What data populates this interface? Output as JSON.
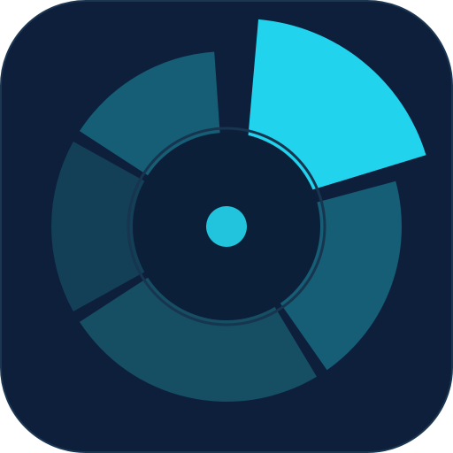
{
  "icon": {
    "semantic": "radial-segment-chart-app-icon",
    "colors": {
      "background": "#0d1f3b",
      "border": "#1c3550",
      "inner_disc": "#0c1f39",
      "inner_ring": "#17354f",
      "center_dot": "#22c4dd",
      "gap": "#0d1f3b"
    },
    "segments": [
      {
        "id": "highlight",
        "color": "#22d3ee",
        "detached": true
      },
      {
        "id": "right",
        "color": "#155e75"
      },
      {
        "id": "bottom",
        "color": "#164e63"
      },
      {
        "id": "left",
        "color": "#133f57"
      },
      {
        "id": "upper-left",
        "color": "#155e75"
      }
    ]
  }
}
